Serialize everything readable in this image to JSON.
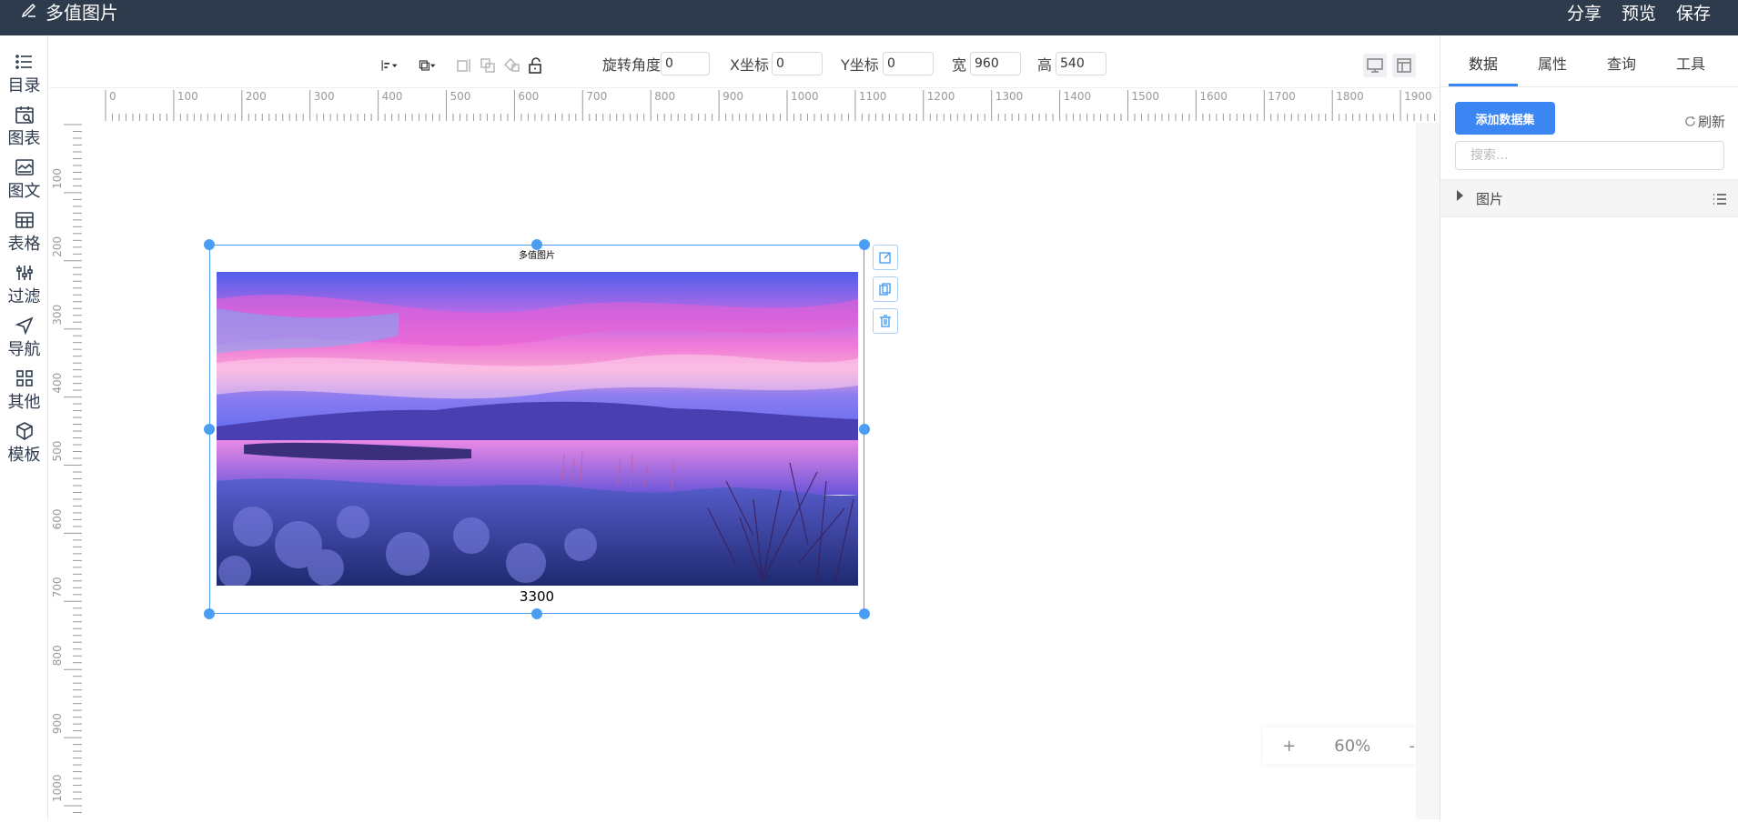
{
  "app": {
    "title": "多值图片"
  },
  "header": {
    "actions": [
      "分享",
      "预览",
      "保存"
    ]
  },
  "sidebar": {
    "items": [
      {
        "label": "目录",
        "icon": "list-icon"
      },
      {
        "label": "图表",
        "icon": "calendar-chart-icon"
      },
      {
        "label": "图文",
        "icon": "image-text-icon"
      },
      {
        "label": "表格",
        "icon": "table-icon"
      },
      {
        "label": "过滤",
        "icon": "filter-icon"
      },
      {
        "label": "导航",
        "icon": "navigation-icon"
      },
      {
        "label": "其他",
        "icon": "grid-icon"
      },
      {
        "label": "模板",
        "icon": "template-icon"
      }
    ]
  },
  "toolbar": {
    "rotation_label": "旋转角度",
    "rotation_value": "0",
    "x_label": "X坐标",
    "x_value": "0",
    "y_label": "Y坐标",
    "y_value": "0",
    "width_label": "宽",
    "width_value": "960",
    "height_label": "高",
    "height_value": "540"
  },
  "ruler": {
    "h_labels": [
      "0",
      "100",
      "200",
      "300",
      "400",
      "500",
      "600",
      "700",
      "800",
      "900",
      "1000",
      "1100",
      "1200",
      "1300",
      "1400",
      "1500",
      "1600",
      "1700",
      "1800",
      "1900"
    ],
    "v_labels": [
      "100",
      "200",
      "300",
      "400",
      "500",
      "600",
      "700",
      "800",
      "900",
      "1000"
    ]
  },
  "widget": {
    "title": "多值图片",
    "caption": "3300"
  },
  "zoom": {
    "plus": "+",
    "level": "60%",
    "minus": "-"
  },
  "right_panel": {
    "tabs": [
      "数据",
      "属性",
      "查询",
      "工具"
    ],
    "active_tab": 0,
    "add_dataset_label": "添加数据集",
    "refresh_label": "刷新",
    "search_placeholder": "搜索...",
    "tree_item_label": "图片"
  },
  "colors": {
    "topbar": "#2e3b4c",
    "accent": "#3c86f4",
    "selection": "#4a9ff5"
  }
}
